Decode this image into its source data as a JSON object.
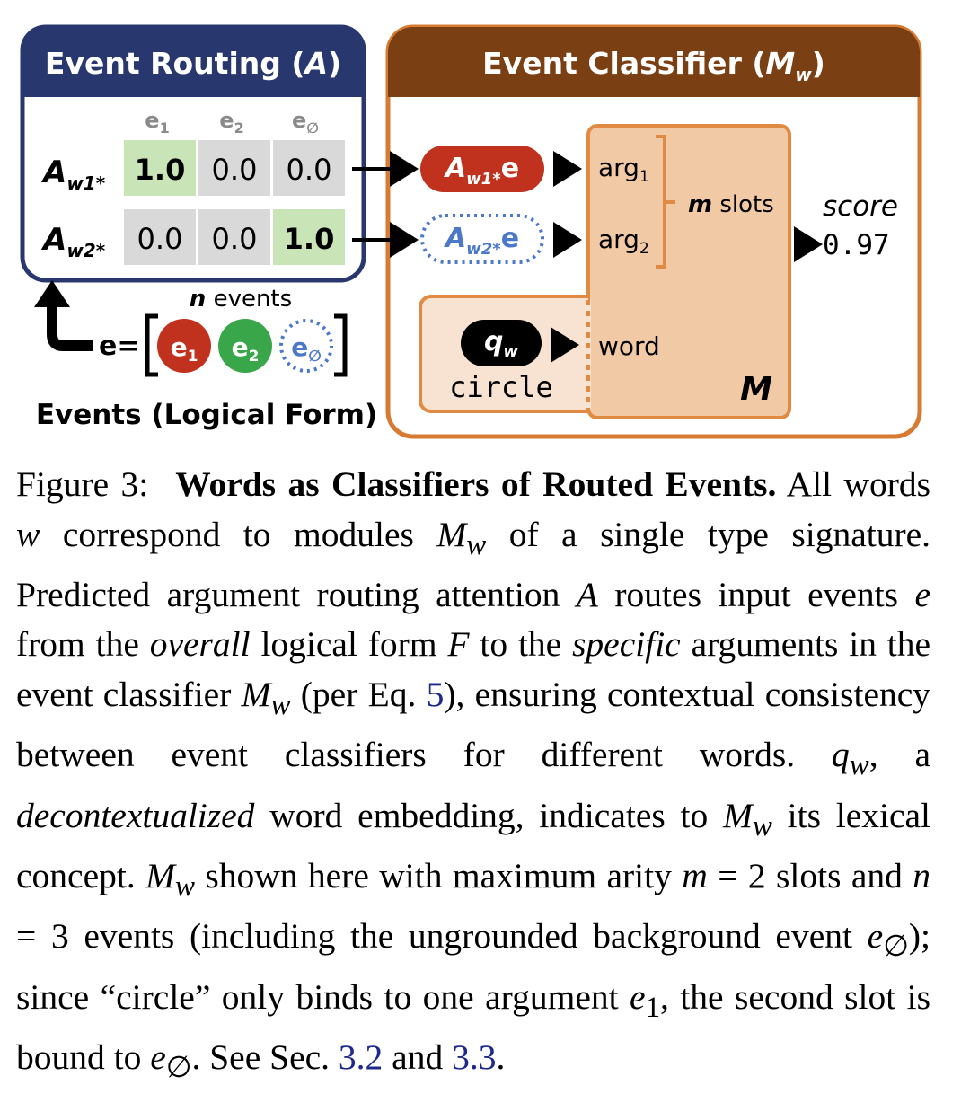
{
  "figure": {
    "routing": {
      "title_prefix": "Event Routing (",
      "title_var": "A",
      "title_suffix": ")",
      "col_headers": [
        "e",
        "e",
        "e"
      ],
      "col_subs": [
        "1",
        "2",
        "∅"
      ],
      "rows": [
        {
          "label_main": "A",
          "label_sub": "w1*",
          "cells": [
            "1.0",
            "0.0",
            "0.0"
          ]
        },
        {
          "label_main": "A",
          "label_sub": "w2*",
          "cells": [
            "0.0",
            "0.0",
            "1.0"
          ]
        }
      ]
    },
    "events": {
      "count_var": "n",
      "count_label": "events",
      "eq_label": "e=",
      "chips": [
        {
          "main": "e",
          "sub": "1"
        },
        {
          "main": "e",
          "sub": "2"
        },
        {
          "main": "e",
          "sub": "∅"
        }
      ],
      "caption": "Events (Logical Form)"
    },
    "classifier": {
      "title_prefix": "Event Classifier (",
      "title_var": "M",
      "title_sub": "w",
      "title_suffix": ")",
      "pill1": {
        "main": "A",
        "sub": "w1*",
        "tail": "e"
      },
      "pill2": {
        "main": "A",
        "sub": "w2*",
        "tail": "e"
      },
      "arg1": {
        "main": "arg",
        "sub": "1"
      },
      "arg2": {
        "main": "arg",
        "sub": "2"
      },
      "slots_var": "m",
      "slots_label": "slots",
      "score_label": "score",
      "score_value": "0.97",
      "qw": {
        "main": "q",
        "sub": "w"
      },
      "word_text": "circle",
      "word_label": "word",
      "module_label": "M"
    },
    "colors": {
      "navy": "#28386e",
      "brown": "#7a3f13",
      "orange": "#d77a32",
      "peach": "#f2c9a5",
      "light_peach": "#f8e3d2",
      "red": "#c0321d",
      "green": "#3aa64a",
      "blue_dotted": "#4b78c9",
      "cell_green": "#c9e5b8",
      "cell_gray": "#d9d9d9"
    }
  },
  "caption": {
    "label": "Figure 3:",
    "title": "Words as Classifiers of Routed Events.",
    "s1": "All words",
    "v_w": "w",
    "s2": "correspond to modules",
    "v_Mw": "M",
    "v_Mw_sub": "w",
    "s3": "of a single type signature. Predicted argument routing attention",
    "v_A": "A",
    "s4": "routes input events",
    "v_e": "e",
    "s5": "from the",
    "i_overall": "overall",
    "s6": "logical form",
    "v_F": "F",
    "s7": "to the",
    "i_specific": "specific",
    "s8": "arguments in the event classifier",
    "s9": "(per Eq.",
    "ref_eq": "5",
    "s10": "), ensuring contextual consistency between event classifiers for different words.",
    "v_q": "q",
    "v_q_sub": "w",
    "s11": ", a",
    "i_decontext": "decontextualized",
    "s12": "word embedding, indicates to",
    "s13": "its lexical concept.",
    "s14": "shown here with maximum arity",
    "v_m": "m",
    "s15": "= 2 slots and",
    "v_n": "n",
    "s16": "= 3 events (including the ungrounded background event",
    "v_e0_sub": "∅",
    "s17": "); since “circle” only binds to one argument",
    "v_e1_sub": "1",
    "s18": ", the second slot is bound to",
    "s19": ". See Sec.",
    "ref_s1": "3.2",
    "s20": "and",
    "ref_s2": "3.3",
    "s21": "."
  }
}
